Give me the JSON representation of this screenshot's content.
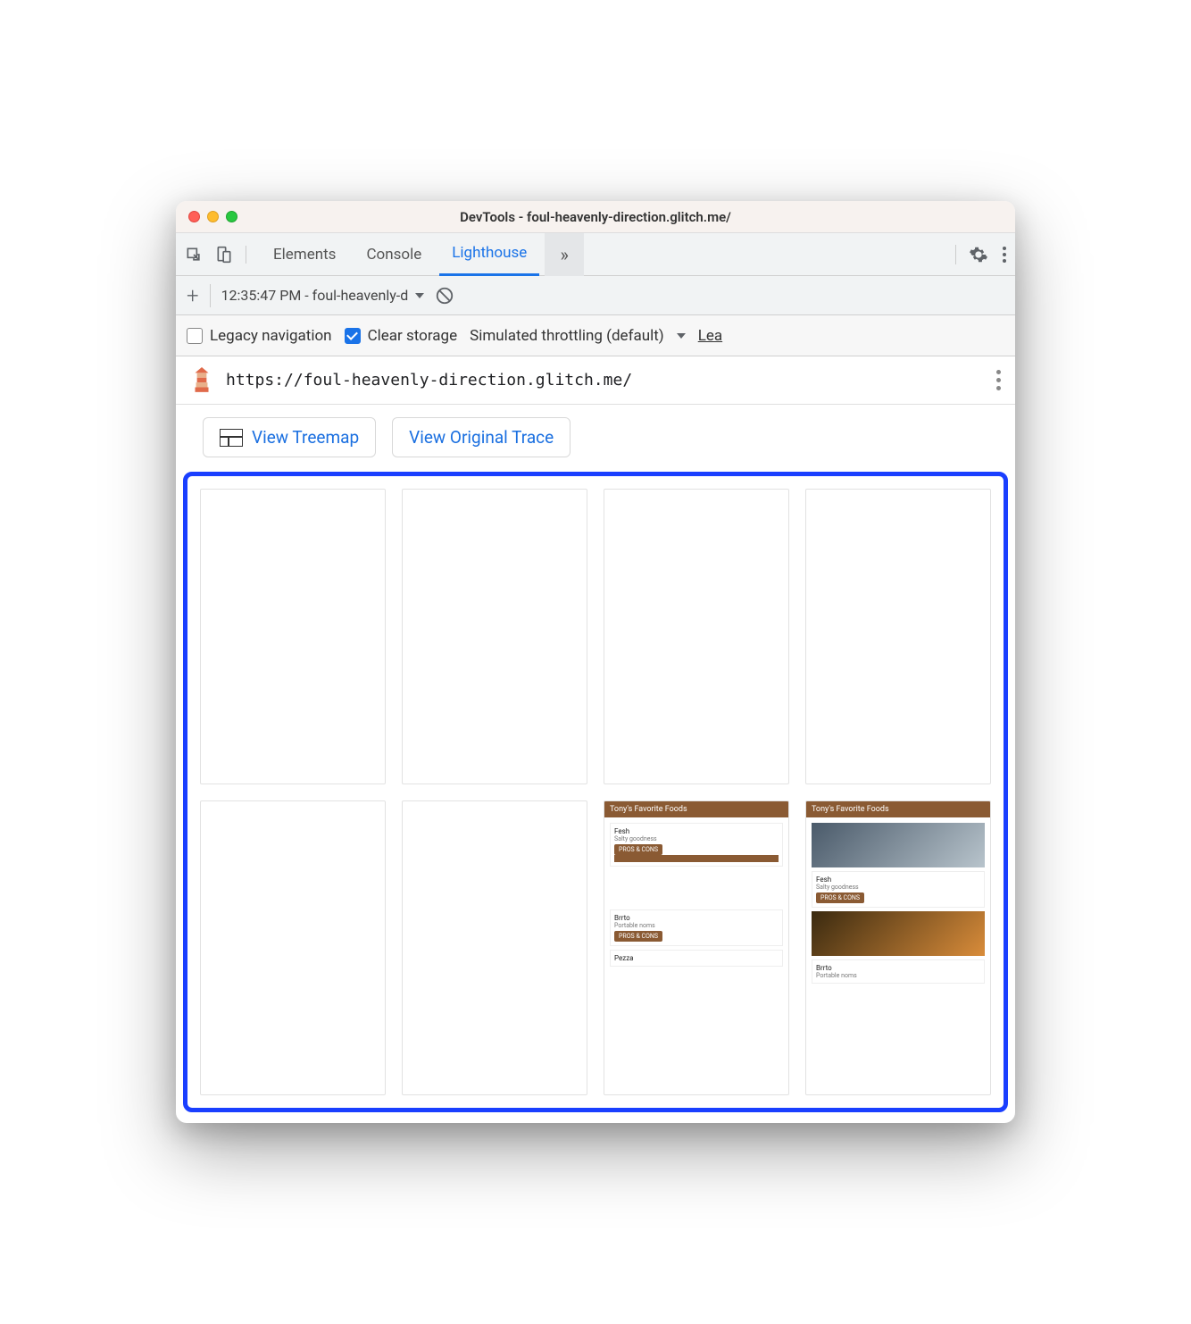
{
  "window": {
    "title": "DevTools - foul-heavenly-direction.glitch.me/"
  },
  "tabs": {
    "elements": "Elements",
    "console": "Console",
    "lighthouse": "Lighthouse"
  },
  "report": {
    "label": "12:35:47 PM - foul-heavenly-d"
  },
  "options": {
    "legacy": "Legacy navigation",
    "clear": "Clear storage",
    "throttling": "Simulated throttling (default)",
    "learn": "Lea"
  },
  "url": {
    "value": "https://foul-heavenly-direction.glitch.me/"
  },
  "buttons": {
    "treemap": "View Treemap",
    "trace": "View Original Trace"
  },
  "thumb": {
    "header": "Tony's Favorite Foods",
    "item1_title": "Fesh",
    "item1_sub": "Salty goodness",
    "item2_title": "Brrto",
    "item2_sub": "Portable noms",
    "item3_title": "Pezza",
    "btn": "PROS & CONS"
  }
}
